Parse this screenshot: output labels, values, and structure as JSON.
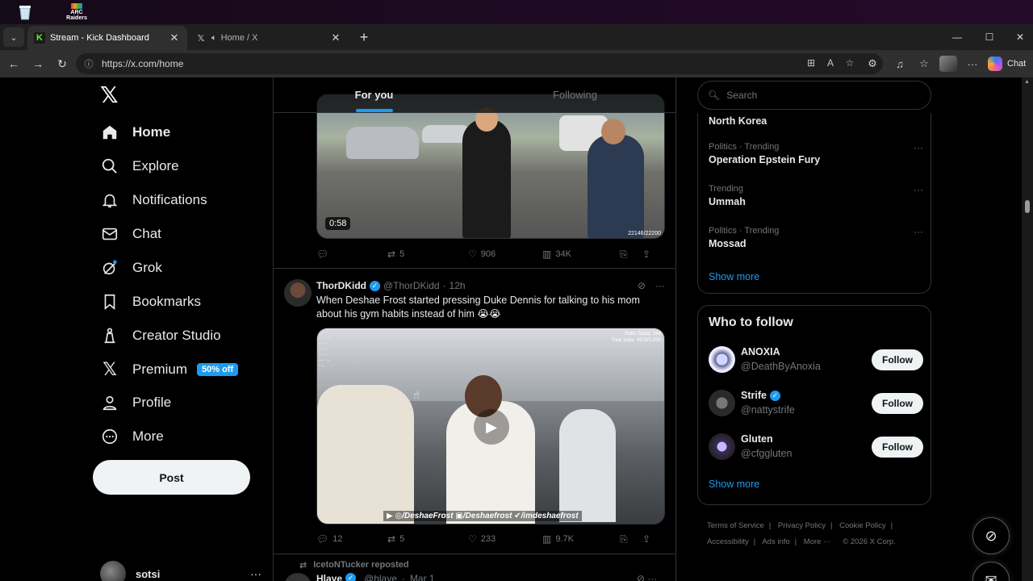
{
  "browser": {
    "tabs": [
      {
        "title": "Stream - Kick Dashboard",
        "active": true
      },
      {
        "title": "Home / X",
        "active": false
      }
    ],
    "url": "https://x.com/home",
    "copilot_label": "Chat"
  },
  "nav": {
    "items": [
      {
        "label": "Home",
        "icon": "home-icon",
        "active": true
      },
      {
        "label": "Explore",
        "icon": "search-icon"
      },
      {
        "label": "Notifications",
        "icon": "bell-icon"
      },
      {
        "label": "Chat",
        "icon": "mail-icon"
      },
      {
        "label": "Grok",
        "icon": "grok-icon"
      },
      {
        "label": "Bookmarks",
        "icon": "bookmark-icon"
      },
      {
        "label": "Creator Studio",
        "icon": "creator-icon"
      },
      {
        "label": "Premium",
        "icon": "x-icon"
      },
      {
        "label": "Profile",
        "icon": "person-icon"
      },
      {
        "label": "More",
        "icon": "more-circle-icon"
      }
    ],
    "premium_badge": "50% off",
    "post_label": "Post",
    "account_name": "sotsi"
  },
  "feed": {
    "tabs": [
      "For you",
      "Following"
    ],
    "tweet1": {
      "duration": "0:58",
      "overlay_counter": "22146/22200",
      "replies": "",
      "reposts": "5",
      "likes": "906",
      "views": "34K"
    },
    "tweet2": {
      "display_name": "ThorDKidd",
      "handle": "@ThorDKidd",
      "time": "12h",
      "text": "When Deshae Frost started pressing Duke Dennis for talking to his mom about his gym habits instead of him 😭😭",
      "subs_overlay": "Subs Today: 348\nTotal Subs: 4378/2,000",
      "social_strip": "▶ ◎/DeshaeFrost ▣/Deshaefrost ✔/imdeshaefrost",
      "replies": "12",
      "reposts": "5",
      "likes": "233",
      "views": "9.7K"
    },
    "tweet3": {
      "repost_by": "IcetoNTucker reposted",
      "display_name": "Hlaye",
      "handle": "@hlaye",
      "time": "Mar 1"
    }
  },
  "sidebar": {
    "search_placeholder": "Search",
    "trends": [
      {
        "meta": "",
        "name": "North Korea"
      },
      {
        "meta": "Politics · Trending",
        "name": "Operation Epstein Fury"
      },
      {
        "meta": "Trending",
        "name": "Ummah"
      },
      {
        "meta": "Politics · Trending",
        "name": "Mossad"
      }
    ],
    "show_more": "Show more",
    "who_to_follow_title": "Who to follow",
    "follow_suggestions": [
      {
        "name": "ANOXIA",
        "handle": "@DeathByAnoxia",
        "verified": false
      },
      {
        "name": "Strife",
        "handle": "@nattystrife",
        "verified": true
      },
      {
        "name": "Gluten",
        "handle": "@cfggluten",
        "verified": false
      }
    ],
    "follow_label": "Follow",
    "footer_links": [
      "Terms of Service",
      "Privacy Policy",
      "Cookie Policy",
      "Accessibility",
      "Ads info",
      "More ···",
      "© 2026 X Corp."
    ]
  }
}
